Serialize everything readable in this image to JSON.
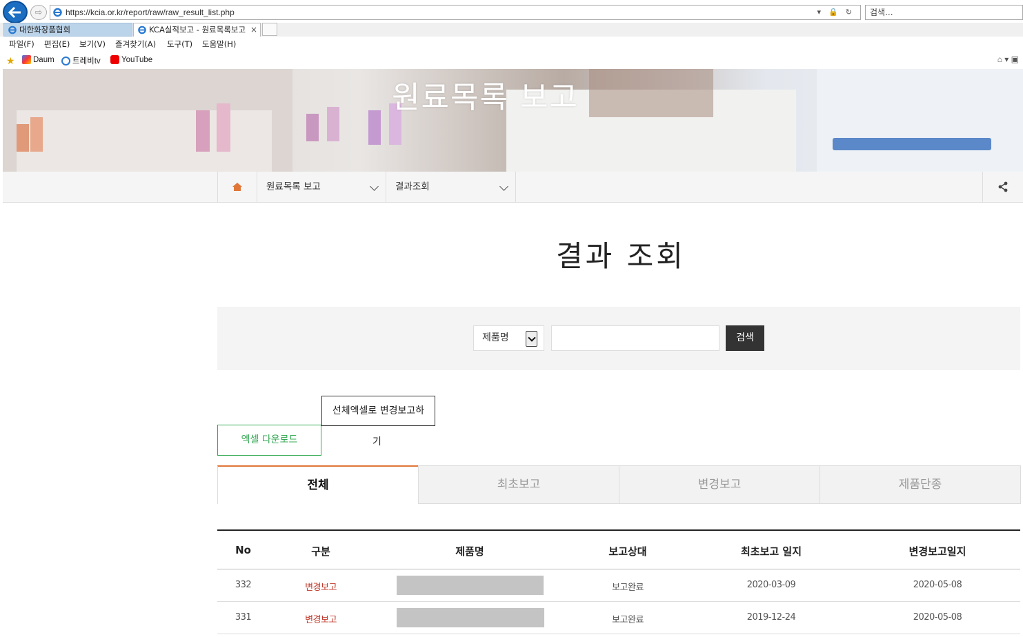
{
  "browser": {
    "url": "https://kcia.or.kr/report/raw/raw_result_list.php",
    "search_placeholder": "검색...",
    "tabs": [
      {
        "label": "대한화장품협회"
      },
      {
        "label": "KCA실적보고 - 원료목록보고",
        "close": "×"
      }
    ],
    "menu": [
      "파일(F)",
      "편집(E)",
      "보기(V)",
      "즐겨찾기(A)",
      "도구(T)",
      "도움말(H)"
    ],
    "favorites": [
      "Daum",
      "트레비tv",
      "YouTube"
    ]
  },
  "banner": {
    "title": "원료목록 보고"
  },
  "nav": {
    "menu1": "원료목록 보고",
    "menu2": "결과조회"
  },
  "page": {
    "title": "결과 조회"
  },
  "search": {
    "select_value": "제품명",
    "keyword": "",
    "button": "검색"
  },
  "actions": {
    "excel": "엑셀 다운로드",
    "bulk_line1": "선체엑셀로 변경보고하",
    "bulk_line2": "기"
  },
  "tabs": [
    "전체",
    "최초보고",
    "변경보고",
    "제품단종"
  ],
  "table": {
    "headers": [
      "No",
      "구분",
      "제품명",
      "보고상대",
      "최초보고 일지",
      "변경보고일지"
    ],
    "rows": [
      {
        "no": "332",
        "kind": "변경보고",
        "status": "보고완료",
        "first": "2020-03-09",
        "changed": "2020-05-08"
      },
      {
        "no": "331",
        "kind": "변경보고",
        "status": "보고완료",
        "first": "2019-12-24",
        "changed": "2020-05-08"
      }
    ]
  },
  "colors": {
    "accent": "#e07638",
    "excel_green": "#34a853",
    "kind_red": "#c0392b"
  }
}
